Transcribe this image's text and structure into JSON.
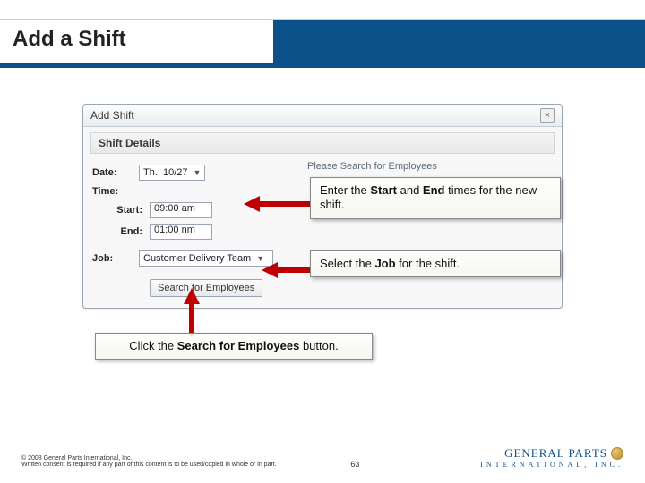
{
  "page": {
    "title": "Add a Shift",
    "page_number": "63"
  },
  "dialog": {
    "title": "Add Shift",
    "panel_header": "Shift Details",
    "right_prompt": "Please Search for Employees",
    "fields": {
      "date_label": "Date:",
      "date_value": "Th., 10/27",
      "time_label": "Time:",
      "start_label": "Start:",
      "start_value": "09:00 am",
      "end_label": "End:",
      "end_value": "01:00 nm",
      "job_label": "Job:",
      "job_value": "Customer Delivery Team"
    },
    "search_button": "Search for Employees"
  },
  "callouts": {
    "c1_pre": "Enter the ",
    "c1_b1": "Start",
    "c1_mid": " and ",
    "c1_b2": "End",
    "c1_post": " times for the new shift.",
    "c2_pre": "Select the ",
    "c2_b1": "Job",
    "c2_post": " for the shift.",
    "c3_pre": "Click the ",
    "c3_b1": "Search for Employees",
    "c3_post": " button."
  },
  "footer": {
    "copyright": "© 2008 General Parts International, Inc.",
    "disclaimer": "Written consent is required if any part of this content is to be used/copied in whole or in part.",
    "brand_line1": "GENERAL PARTS",
    "brand_line2": "INTERNATIONAL, INC."
  }
}
